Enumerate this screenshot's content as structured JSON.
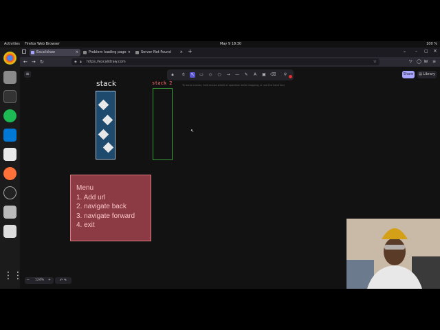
{
  "system": {
    "activities": "Activities",
    "app_name": "Firefox Web Browser",
    "clock": "May 9  18:30",
    "tray": "100 %"
  },
  "browser": {
    "tabs": [
      {
        "label": "Excalidraw",
        "active": true
      },
      {
        "label": "Problem loading page",
        "active": false
      },
      {
        "label": "Server Not Found",
        "active": false
      }
    ],
    "new_tab": "+",
    "url": "https://excalidraw.com"
  },
  "canvas": {
    "menu_icon": "hamburger-icon",
    "hint": "To move canvas, hold mouse wheel or spacebar while dragging, or use the hand tool",
    "share_label": "Share",
    "library_label": "Library",
    "zoom_value": "124%",
    "zoom_minus": "−",
    "zoom_plus": "+",
    "stack_label": "stack",
    "stack2_label": "stack 2",
    "menu_lines": [
      "Menu",
      "1. Add url",
      "2. navigate back",
      "3. navigate forward",
      "4. exit"
    ]
  },
  "colors": {
    "accent": "#a8a5ff",
    "stack_fill": "#1e4a6e",
    "stack2_stroke": "#3a9d3a",
    "menu_fill": "#8c3a43"
  }
}
